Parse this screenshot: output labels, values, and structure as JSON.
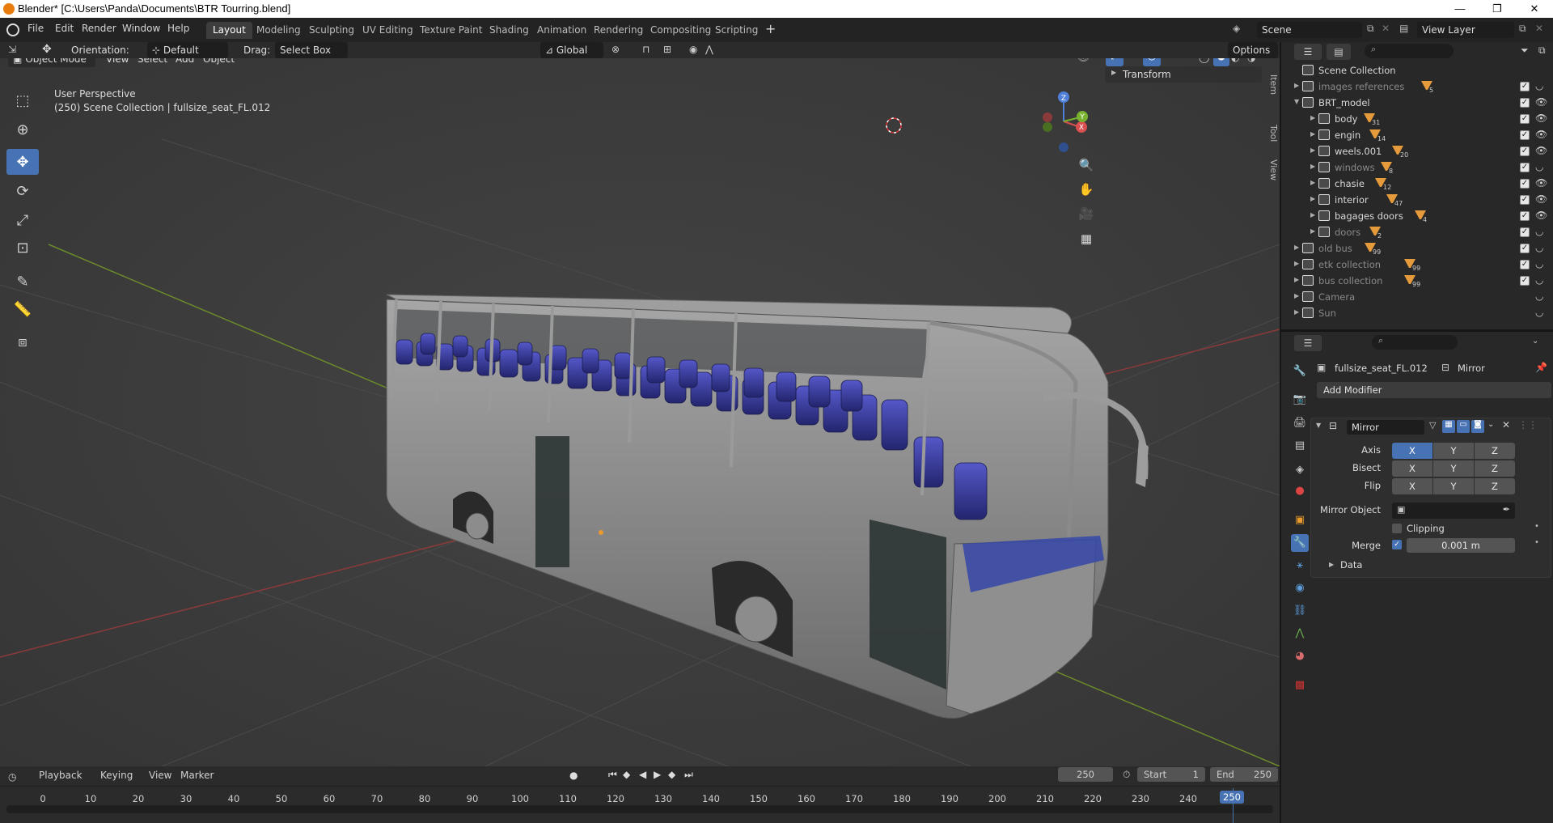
{
  "window": {
    "title": "Blender* [C:\\Users\\Panda\\Documents\\BTR Tourring.blend]",
    "controls": [
      "—",
      "❐",
      "✕"
    ]
  },
  "menubar": [
    "File",
    "Edit",
    "Render",
    "Window",
    "Help"
  ],
  "workspaces": [
    "Layout",
    "Modeling",
    "Sculpting",
    "UV Editing",
    "Texture Paint",
    "Shading",
    "Animation",
    "Rendering",
    "Compositing",
    "Scripting"
  ],
  "active_workspace": "Layout",
  "add_workspace_label": "+",
  "scene": {
    "name": "Scene",
    "view_layer": "View Layer"
  },
  "tool_header": {
    "orientation_label": "Orientation:",
    "orientation_value": "Default",
    "drag_label": "Drag:",
    "drag_value": "Select Box",
    "transform_orientation": "Global",
    "options_label": "Options"
  },
  "viewport_header": {
    "mode": "Object Mode",
    "menus": [
      "View",
      "Select",
      "Add",
      "Object"
    ]
  },
  "viewport": {
    "perspective": "User Perspective",
    "info": "(250) Scene Collection | fullsize_seat_FL.012",
    "transform_panel": "Transform",
    "side_tabs": [
      "Item",
      "Tool",
      "View"
    ],
    "gizmo": {
      "x": "X",
      "y": "Y",
      "z": "Z"
    }
  },
  "toolbar_icons": [
    "select-box-icon",
    "cursor-icon",
    "move-icon",
    "rotate-icon",
    "scale-icon",
    "transform-icon",
    "annotate-icon",
    "measure-icon",
    "add-cube-icon"
  ],
  "outliner": {
    "root": "Scene Collection",
    "rows": [
      {
        "name": "images references",
        "count": "5",
        "dim": true,
        "indent": 1
      },
      {
        "name": "BRT_model",
        "count": "",
        "dim": false,
        "indent": 1,
        "expanded": true
      },
      {
        "name": "body",
        "count": "31",
        "dim": false,
        "indent": 2
      },
      {
        "name": "engin",
        "count": "14",
        "dim": false,
        "indent": 2
      },
      {
        "name": "weels.001",
        "count": "20",
        "dim": false,
        "indent": 2
      },
      {
        "name": "windows",
        "count": "8",
        "dim": true,
        "indent": 2
      },
      {
        "name": "chasie",
        "count": "12",
        "dim": false,
        "indent": 2
      },
      {
        "name": "interior",
        "count": "47",
        "dim": false,
        "indent": 2
      },
      {
        "name": "bagages doors",
        "count": "4",
        "dim": false,
        "indent": 2
      },
      {
        "name": "doors",
        "count": "2",
        "dim": true,
        "indent": 2
      },
      {
        "name": "old bus",
        "count": "99",
        "dim": true,
        "indent": 1
      },
      {
        "name": "etk collection",
        "count": "99",
        "dim": true,
        "indent": 1
      },
      {
        "name": "bus collection",
        "count": "99",
        "dim": true,
        "indent": 1
      },
      {
        "name": "Camera",
        "count": "",
        "dim": true,
        "indent": 1
      },
      {
        "name": "Sun",
        "count": "",
        "dim": true,
        "indent": 1
      }
    ]
  },
  "properties": {
    "object_name": "fullsize_seat_FL.012",
    "modifier_crumb": "Mirror",
    "add_modifier": "Add Modifier",
    "modifier": {
      "name": "Mirror",
      "axis_label": "Axis",
      "bisect_label": "Bisect",
      "flip_label": "Flip",
      "xyz": [
        "X",
        "Y",
        "Z"
      ],
      "axis_active": [
        true,
        false,
        false
      ],
      "mirror_object_label": "Mirror Object",
      "clipping_label": "Clipping",
      "merge_label": "Merge",
      "merge_value": "0.001 m",
      "data_label": "Data"
    }
  },
  "timeline": {
    "menus": [
      "Playback",
      "Keying",
      "View",
      "Marker"
    ],
    "current_frame": "250",
    "start_label": "Start",
    "start_value": "1",
    "end_label": "End",
    "end_value": "250",
    "ticks": [
      "0",
      "10",
      "20",
      "30",
      "40",
      "50",
      "60",
      "70",
      "80",
      "90",
      "100",
      "110",
      "120",
      "130",
      "140",
      "150",
      "160",
      "170",
      "180",
      "190",
      "200",
      "210",
      "220",
      "230",
      "240"
    ],
    "playhead_label": "250"
  }
}
